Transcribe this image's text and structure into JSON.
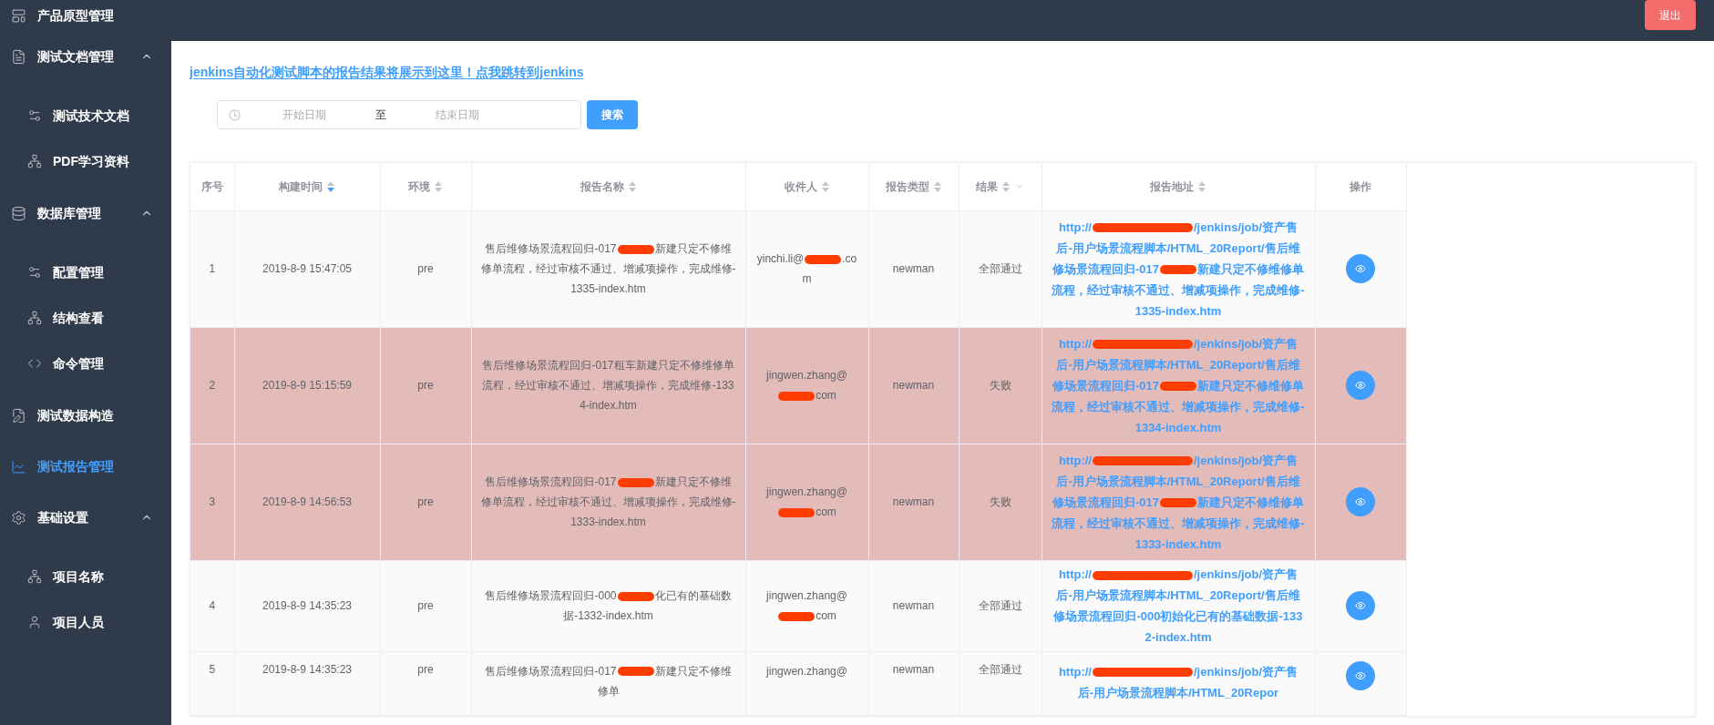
{
  "header": {
    "logout": "退出"
  },
  "sidebar": {
    "items": [
      {
        "label": "产品原型管理",
        "selected": false
      },
      {
        "label": "测试文档管理",
        "selected": false,
        "expanded": true,
        "children": [
          {
            "label": "测试技术文档",
            "selected": false
          },
          {
            "label": "PDF学习资料",
            "selected": false
          }
        ]
      },
      {
        "label": "数据库管理",
        "selected": false,
        "expanded": true,
        "children": [
          {
            "label": "配置管理",
            "selected": false
          },
          {
            "label": "结构查看",
            "selected": false
          },
          {
            "label": "命令管理",
            "selected": false
          }
        ]
      },
      {
        "label": "测试数据构造",
        "selected": false
      },
      {
        "label": "测试报告管理",
        "selected": true
      },
      {
        "label": "基础设置",
        "selected": false,
        "expanded": true,
        "children": [
          {
            "label": "项目名称",
            "selected": false
          },
          {
            "label": "项目人员",
            "selected": false
          }
        ]
      }
    ]
  },
  "notice_link": "jenkins自动化测试脚本的报告结果将展示到这里！点我跳转到jenkins",
  "date_range": {
    "start_placeholder": "开始日期",
    "separator": "至",
    "end_placeholder": "结束日期"
  },
  "search_button": "搜索",
  "table": {
    "columns": [
      {
        "label": "序号",
        "sortable": false,
        "filter": false
      },
      {
        "label": "构建时间",
        "sortable": true,
        "sort_active": true,
        "filter": false
      },
      {
        "label": "环境",
        "sortable": true,
        "sort_active": false,
        "filter": false
      },
      {
        "label": "报告名称",
        "sortable": true,
        "sort_active": false,
        "filter": false
      },
      {
        "label": "收件人",
        "sortable": true,
        "sort_active": false,
        "filter": false
      },
      {
        "label": "报告类型",
        "sortable": true,
        "sort_active": false,
        "filter": false
      },
      {
        "label": "结果",
        "sortable": true,
        "sort_active": false,
        "filter": true
      },
      {
        "label": "报告地址",
        "sortable": true,
        "sort_active": false,
        "filter": false
      },
      {
        "label": "操作",
        "sortable": false,
        "filter": false
      }
    ],
    "rows": [
      {
        "index": "1",
        "time": "2019-8-9 15:47:05",
        "env": "pre",
        "name": [
          "售后维修场景流程回归-017",
          "新建只定不修维修单流程，经过审核不通过、增减项操作，完成维修-1335-index.htm"
        ],
        "recipient": [
          "yinchi.li@",
          ".com"
        ],
        "type": "newman",
        "result": "全部通过",
        "highlighted": false,
        "address": [
          "http://",
          "/jenkins/job/资产售后-用户场景流程脚本/HTML_20Report/售后维修场景流程回归-017",
          "新建只定不修维修单流程，经过审核不通过、增减项操作，完成维修-1335-index.htm"
        ]
      },
      {
        "index": "2",
        "time": "2019-8-9 15:15:59",
        "env": "pre",
        "name": [
          "售后维修场景流程回归-017租车新建只定不修维修单流程，经过审核不通过、增减项操作，完成维修-1334-index.htm"
        ],
        "recipient": [
          "jingwen.zhang@",
          "com"
        ],
        "type": "newman",
        "result": "失败",
        "highlighted": true,
        "address": [
          "http://",
          "/jenkins/job/资产售后-用户场景流程脚本/HTML_20Report/售后维修场景流程回归-017",
          "新建只定不修维修单流程，经过审核不通过、增减项操作，完成维修-1334-index.htm"
        ]
      },
      {
        "index": "3",
        "time": "2019-8-9 14:56:53",
        "env": "pre",
        "name": [
          "售后维修场景流程回归-017",
          "新建只定不修维修单流程，经过审核不通过、增减项操作，完成维修-1333-index.htm"
        ],
        "recipient": [
          "jingwen.zhang@",
          "com"
        ],
        "type": "newman",
        "result": "失败",
        "highlighted": true,
        "address": [
          "http://",
          "/jenkins/job/资产售后-用户场景流程脚本/HTML_20Report/售后维修场景流程回归-017",
          "新建只定不修维修单流程，经过审核不通过、增减项操作，完成维修-1333-index.htm"
        ]
      },
      {
        "index": "4",
        "time": "2019-8-9 14:35:23",
        "env": "pre",
        "name": [
          "售后维修场景流程回归-000",
          "化已有的基础数据-1332-index.htm"
        ],
        "recipient": [
          "jingwen.zhang@",
          "com"
        ],
        "type": "newman",
        "result": "全部通过",
        "highlighted": false,
        "address": [
          "http://",
          "/jenkins/job/资产售后-用户场景流程脚本/HTML_20Report/售后维修场景流程回归-000初始化已有的基础数据-1332-index.htm"
        ]
      },
      {
        "index": "5",
        "time": "2019-8-9 14:35:23",
        "env": "pre",
        "name": [
          "售后维修场景流程回归-017",
          "新建只定不修维修单"
        ],
        "recipient": [
          "jingwen.zhang@"
        ],
        "type": "newman",
        "result": "全部通过",
        "highlighted": false,
        "address": [
          "http://",
          "/jenkins/job/资产售后-用户场景流程脚本/HTML_20Repor"
        ]
      }
    ]
  }
}
